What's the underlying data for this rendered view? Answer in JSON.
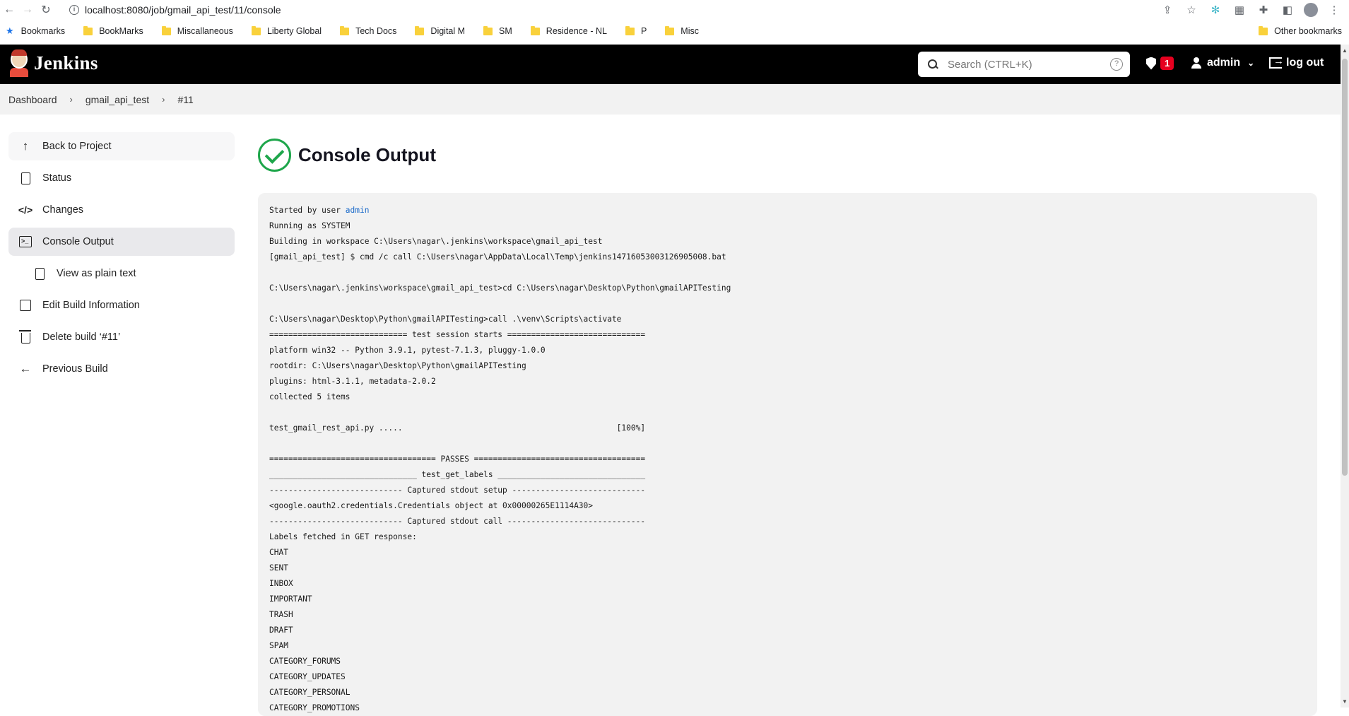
{
  "browser": {
    "url": "localhost:8080/job/gmail_api_test/11/console",
    "bookmarks": [
      {
        "label": "Bookmarks",
        "type": "star"
      },
      {
        "label": "BookMarks",
        "type": "folder"
      },
      {
        "label": "Miscallaneous",
        "type": "folder"
      },
      {
        "label": "Liberty Global",
        "type": "folder"
      },
      {
        "label": "Tech Docs",
        "type": "folder"
      },
      {
        "label": "Digital M",
        "type": "folder"
      },
      {
        "label": "SM",
        "type": "folder"
      },
      {
        "label": "Residence - NL",
        "type": "folder"
      },
      {
        "label": "P",
        "type": "folder"
      },
      {
        "label": "Misc",
        "type": "folder"
      }
    ],
    "other_bookmarks": "Other bookmarks"
  },
  "header": {
    "brand": "Jenkins",
    "search_placeholder": "Search (CTRL+K)",
    "help_glyph": "?",
    "alert_count": "1",
    "user": "admin",
    "logout": "log out"
  },
  "breadcrumb": {
    "items": [
      "Dashboard",
      "gmail_api_test",
      "#11"
    ]
  },
  "sidebar": {
    "items": [
      {
        "label": "Back to Project",
        "icon": "arrow-up-icon"
      },
      {
        "label": "Status",
        "icon": "document-icon"
      },
      {
        "label": "Changes",
        "icon": "code-icon"
      },
      {
        "label": "Console Output",
        "icon": "terminal-icon",
        "active": true
      },
      {
        "label": "View as plain text",
        "icon": "document-icon",
        "sub": true
      },
      {
        "label": "Edit Build Information",
        "icon": "edit-icon"
      },
      {
        "label": "Delete build ‘#11’",
        "icon": "trash-icon"
      },
      {
        "label": "Previous Build",
        "icon": "arrow-left-icon"
      }
    ]
  },
  "main": {
    "title": "Console Output",
    "status_color": "#1ea64b",
    "console": {
      "started_prefix": "Started by user ",
      "started_user": "admin",
      "lines": [
        "Running as SYSTEM",
        "Building in workspace C:\\Users\\nagar\\.jenkins\\workspace\\gmail_api_test",
        "[gmail_api_test] $ cmd /c call C:\\Users\\nagar\\AppData\\Local\\Temp\\jenkins14716053003126905008.bat",
        "",
        "C:\\Users\\nagar\\.jenkins\\workspace\\gmail_api_test>cd C:\\Users\\nagar\\Desktop\\Python\\gmailAPITesting",
        "",
        "C:\\Users\\nagar\\Desktop\\Python\\gmailAPITesting>call .\\venv\\Scripts\\activate",
        "============================= test session starts =============================",
        "platform win32 -- Python 3.9.1, pytest-7.1.3, pluggy-1.0.0",
        "rootdir: C:\\Users\\nagar\\Desktop\\Python\\gmailAPITesting",
        "plugins: html-3.1.1, metadata-2.0.2",
        "collected 5 items",
        "",
        "test_gmail_rest_api.py .....                                             [100%]",
        "",
        "=================================== PASSES ====================================",
        "_______________________________ test_get_labels _______________________________",
        "---------------------------- Captured stdout setup ----------------------------",
        "<google.oauth2.credentials.Credentials object at 0x00000265E1114A30>",
        "---------------------------- Captured stdout call -----------------------------",
        "Labels fetched in GET response:",
        "CHAT",
        "SENT",
        "INBOX",
        "IMPORTANT",
        "TRASH",
        "DRAFT",
        "SPAM",
        "CATEGORY_FORUMS",
        "CATEGORY_UPDATES",
        "CATEGORY_PERSONAL",
        "CATEGORY_PROMOTIONS"
      ]
    }
  }
}
